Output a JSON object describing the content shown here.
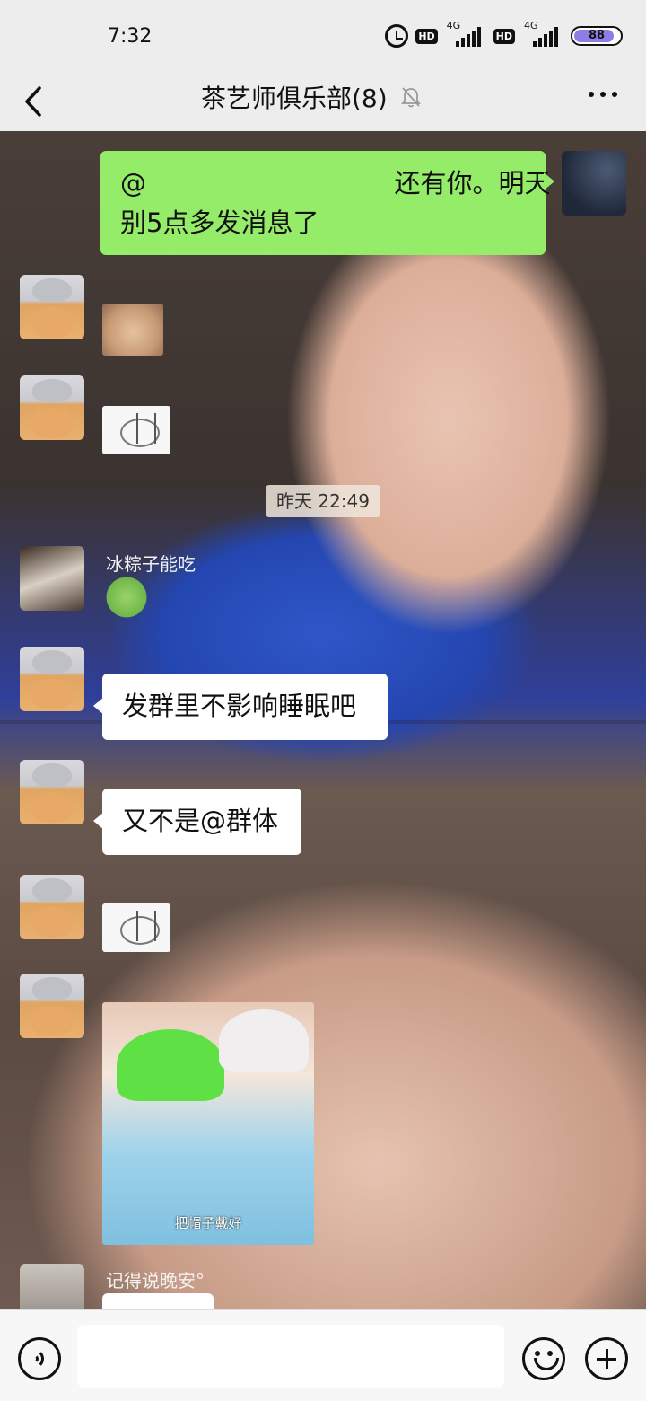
{
  "status_bar": {
    "time": "7:32",
    "hd_label": "HD",
    "network_1": "4G",
    "network_2": "4G",
    "battery_percent": 88
  },
  "header": {
    "title": "茶艺师俱乐部(8)",
    "icons": [
      "back-icon",
      "mute-bell-icon",
      "more-icon"
    ]
  },
  "messages": [
    {
      "type": "text",
      "side": "right",
      "line1": "@                              还有你。明天",
      "line2": "别5点多发消息了"
    },
    {
      "type": "sticker",
      "side": "left",
      "sticker": "grumpy-cat"
    },
    {
      "type": "sticker",
      "side": "left",
      "sticker": "sketch-cat"
    },
    {
      "type": "timestamp",
      "text": "昨天 22:49"
    },
    {
      "type": "sticker",
      "side": "left",
      "sender": "冰粽子能吃",
      "sticker": "green-frog"
    },
    {
      "type": "text",
      "side": "left",
      "text": "发群里不影响睡眠吧"
    },
    {
      "type": "text",
      "side": "left",
      "text": "又不是@群体"
    },
    {
      "type": "sticker",
      "side": "left",
      "sticker": "sketch-cat"
    },
    {
      "type": "image",
      "side": "left",
      "caption": "把帽子戴好"
    },
    {
      "type": "text",
      "side": "left",
      "sender": "记得说晚安°",
      "text": ""
    }
  ],
  "input": {
    "placeholder": "",
    "icons": [
      "voice-icon",
      "emoji-icon",
      "plus-icon"
    ]
  },
  "colors": {
    "outgoing_bubble": "#95ec69",
    "incoming_bubble": "#ffffff",
    "bar_background": "#ededed",
    "battery": "#8f7de6"
  }
}
